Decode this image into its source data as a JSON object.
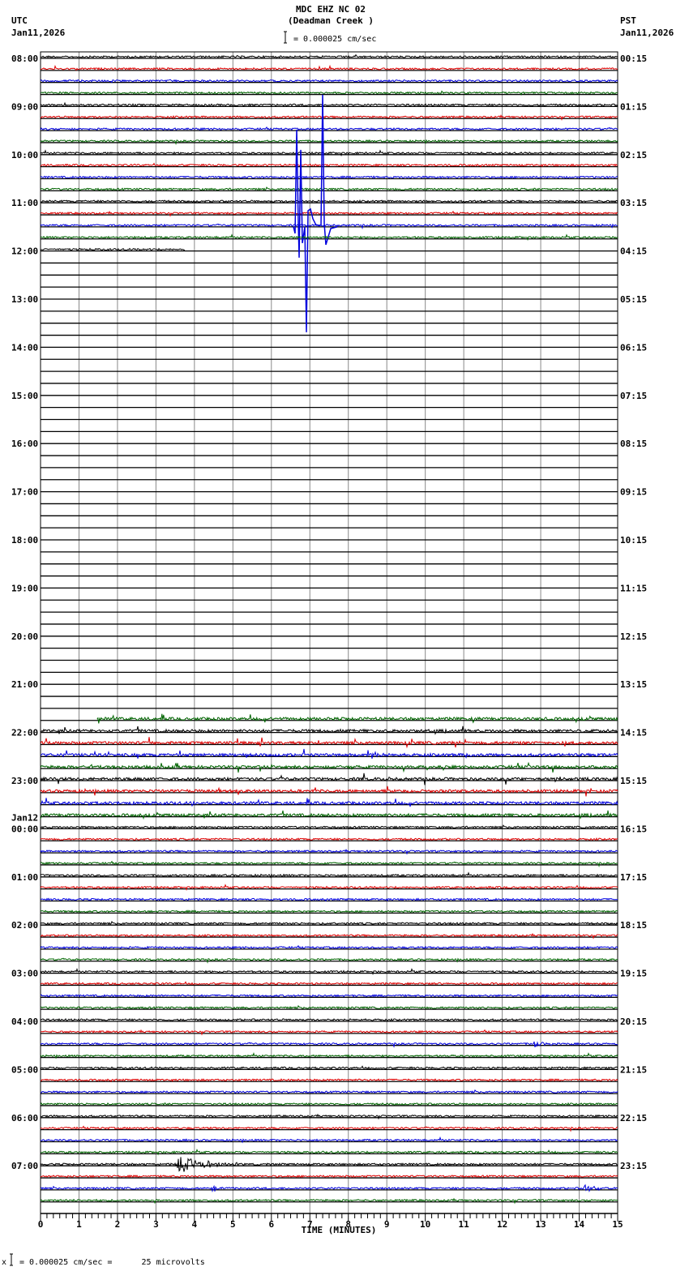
{
  "header": {
    "title": "MDC EHZ NC 02",
    "subtitle": "(Deadman Creek )",
    "scale": "= 0.000025 cm/sec",
    "left_tz": "UTC",
    "left_date": "Jan11,2026",
    "right_tz": "PST",
    "right_date": "Jan11,2026",
    "date_change": "Jan12"
  },
  "footer": {
    "scale_note": "= 0.000025 cm/sec =      25 microvolts",
    "mark": "x"
  },
  "chart_data": {
    "type": "line",
    "title": "MDC EHZ NC 02 (Deadman Creek )",
    "xlabel": "TIME (MINUTES)",
    "xlim": [
      0,
      15
    ],
    "x_ticks": [
      "0",
      "1",
      "2",
      "3",
      "4",
      "5",
      "6",
      "7",
      "8",
      "9",
      "10",
      "11",
      "12",
      "13",
      "14",
      "15"
    ],
    "traces_per_hour": 4,
    "trace_colors": [
      "#000000",
      "#dd0000",
      "#0000dd",
      "#006400"
    ],
    "grid": true,
    "left_labels": [
      "08:00",
      "09:00",
      "10:00",
      "11:00",
      "12:00",
      "13:00",
      "14:00",
      "15:00",
      "16:00",
      "17:00",
      "18:00",
      "19:00",
      "20:00",
      "21:00",
      "22:00",
      "23:00",
      "00:00",
      "01:00",
      "02:00",
      "03:00",
      "04:00",
      "05:00",
      "06:00",
      "07:00"
    ],
    "right_labels": [
      "00:15",
      "01:15",
      "02:15",
      "03:15",
      "04:15",
      "05:15",
      "06:15",
      "07:15",
      "08:15",
      "09:15",
      "10:15",
      "11:15",
      "12:15",
      "13:15",
      "14:15",
      "15:15",
      "16:15",
      "17:15",
      "18:15",
      "19:15",
      "20:15",
      "21:15",
      "22:15",
      "23:15"
    ],
    "data_gap": {
      "from_row": 16,
      "from_minute": 3.75,
      "to_row": 55,
      "to_minute": 1.47
    },
    "events": [
      {
        "row": 14,
        "minute": 6.7,
        "amplitude": 8,
        "type": "teleseism"
      },
      {
        "row": 58,
        "minute": 8.5,
        "amplitude": 0.6,
        "type": "burst"
      },
      {
        "row": 82,
        "minute": 12.8,
        "amplitude": 0.6,
        "type": "burst"
      },
      {
        "row": 92,
        "minute": 3.5,
        "amplitude": 1.2,
        "type": "local"
      },
      {
        "row": 94,
        "minute": 14.1,
        "amplitude": 0.6,
        "type": "burst"
      },
      {
        "row": 94,
        "minute": 4.45,
        "amplitude": 0.4,
        "type": "burst"
      }
    ]
  }
}
